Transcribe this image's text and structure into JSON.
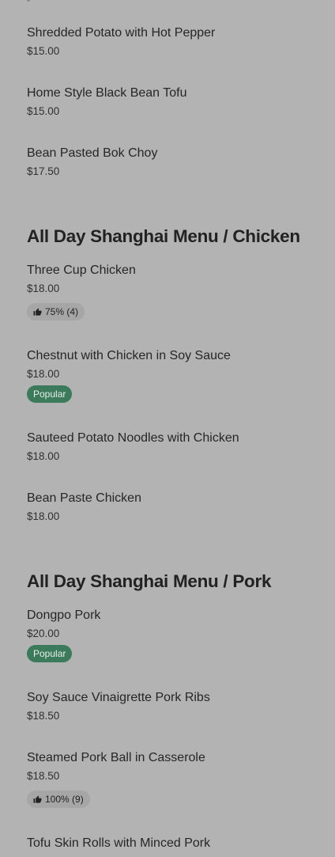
{
  "sections": [
    {
      "title": "",
      "items": [
        {
          "name": "Shredded Potato with Hot Pepper",
          "price": "$15.00"
        },
        {
          "name": "Home Style Black Bean Tofu",
          "price": "$15.00"
        },
        {
          "name": "Bean Pasted Bok Choy",
          "price": "$17.50"
        }
      ]
    },
    {
      "title": "All Day Shanghai Menu / Chicken",
      "items": [
        {
          "name": "Three Cup Chicken",
          "price": "$18.00",
          "rating": "75% (4)"
        },
        {
          "name": "Chestnut with Chicken in Soy Sauce",
          "price": "$18.00",
          "badge": "Popular"
        },
        {
          "name": "Sauteed Potato Noodles with Chicken",
          "price": "$18.00"
        },
        {
          "name": "Bean Paste Chicken",
          "price": "$18.00"
        }
      ]
    },
    {
      "title": "All Day Shanghai Menu / Pork",
      "items": [
        {
          "name": "Dongpo Pork",
          "price": "$20.00",
          "badge": "Popular"
        },
        {
          "name": "Soy Sauce Vinaigrette Pork Ribs",
          "price": "$18.50"
        },
        {
          "name": "Steamed Pork Ball in Casserole",
          "price": "$18.50",
          "rating": "100% (9)"
        },
        {
          "name": "Tofu Skin Rolls with Minced Pork",
          "price": ""
        }
      ]
    }
  ],
  "colors": {
    "background": "#b3b3b3",
    "popular_badge": "#3c7a5c",
    "rating_badge": "#a6a6a6"
  },
  "icons": {
    "rating": "thumbs-up-icon"
  }
}
